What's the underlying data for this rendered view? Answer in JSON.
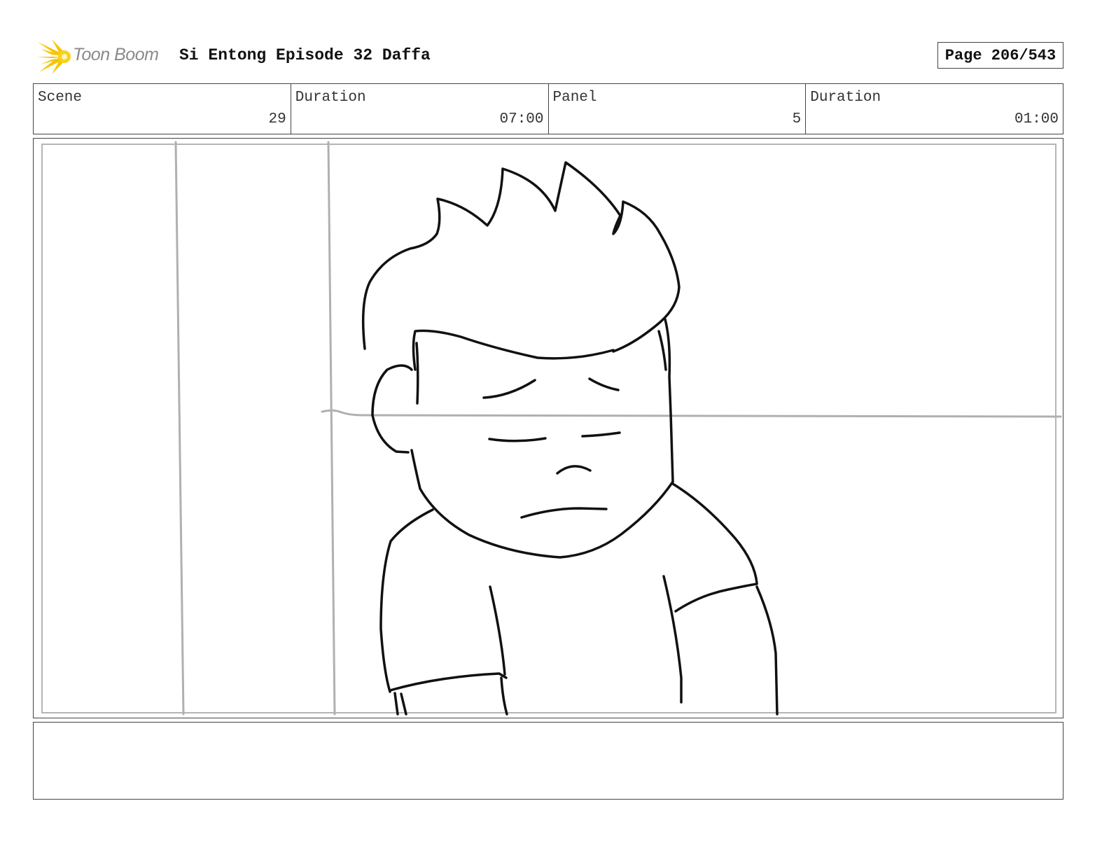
{
  "header": {
    "logo_text": "Toon Boom",
    "project_title": "Si Entong Episode 32 Daffa",
    "page_label": "Page 206/543"
  },
  "info": {
    "scene_label": "Scene",
    "scene_value": "29",
    "scene_duration_label": "Duration",
    "scene_duration_value": "07:00",
    "panel_label": "Panel",
    "panel_value": "5",
    "panel_duration_label": "Duration",
    "panel_duration_value": "01:00"
  },
  "notes": {
    "text": ""
  },
  "colors": {
    "logo_yellow": "#f5c400",
    "logo_text": "#8a8a8a",
    "guide_gray": "#b0b0b0",
    "ink": "#111111"
  },
  "icons": {
    "logo": "starburst-icon"
  }
}
